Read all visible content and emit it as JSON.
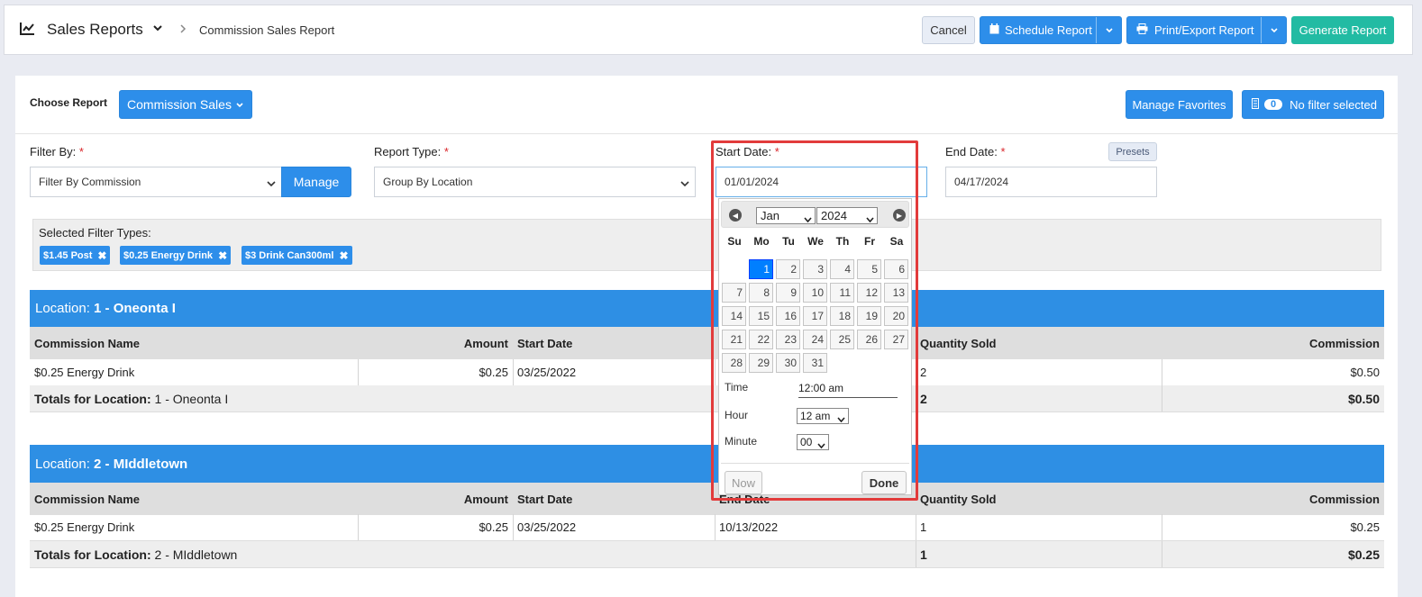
{
  "header": {
    "title": "Sales Reports",
    "breadcrumb": "Commission Sales Report",
    "cancel": "Cancel",
    "schedule": "Schedule Report",
    "print": "Print/Export Report",
    "generate": "Generate Report"
  },
  "toolbar": {
    "choose_label": "Choose Report",
    "report_button": "Commission Sales",
    "favorites": "Manage Favorites",
    "filter_count": "0",
    "filter_text": "No filter selected"
  },
  "filters": {
    "filter_by_label": "Filter By:",
    "filter_by_value": "Filter By Commission",
    "manage": "Manage",
    "report_type_label": "Report Type:",
    "report_type_value": "Group By Location",
    "start_label": "Start Date:",
    "start_value": "01/01/2024",
    "end_label": "End Date:",
    "end_value": "04/17/2024",
    "presets": "Presets",
    "required_mark": "*"
  },
  "selected_filters": {
    "label": "Selected Filter Types:",
    "chips": [
      "$1.45 Post",
      "$0.25 Energy Drink",
      "$3 Drink Can300ml"
    ]
  },
  "columns": {
    "name": "Commission Name",
    "amount": "Amount",
    "start": "Start Date",
    "end": "End Date",
    "qty": "Quantity Sold",
    "commission": "Commission"
  },
  "locations": [
    {
      "prefix": "Location: ",
      "name": "1 - Oneonta I",
      "row": {
        "name": "$0.25 Energy Drink",
        "amount": "$0.25",
        "start": "03/25/2022",
        "end": "",
        "qty": "2",
        "commission": "$0.50"
      },
      "totals_label": "Totals for Location:",
      "totals_name": "1 - Oneonta I",
      "totals_qty": "2",
      "totals_commission": "$0.50"
    },
    {
      "prefix": "Location: ",
      "name": "2 - MIddletown",
      "row": {
        "name": "$0.25 Energy Drink",
        "amount": "$0.25",
        "start": "03/25/2022",
        "end": "10/13/2022",
        "qty": "1",
        "commission": "$0.25"
      },
      "totals_label": "Totals for Location:",
      "totals_name": "2 - MIddletown",
      "totals_qty": "1",
      "totals_commission": "$0.25"
    }
  ],
  "datepicker": {
    "month": "Jan",
    "year": "2024",
    "weekdays": [
      "Su",
      "Mo",
      "Tu",
      "We",
      "Th",
      "Fr",
      "Sa"
    ],
    "first_weekday_index": 1,
    "days_in_month": 31,
    "selected_day": 1,
    "time_label": "Time",
    "time_value": "12:00 am",
    "hour_label": "Hour",
    "hour_value": "12 am",
    "minute_label": "Minute",
    "minute_value": "00",
    "now": "Now",
    "done": "Done"
  },
  "colors": {
    "primary": "#2d8eea",
    "teal": "#22bba3",
    "location_bar": "#2e8fe4",
    "highlight": "#e23b3b"
  }
}
